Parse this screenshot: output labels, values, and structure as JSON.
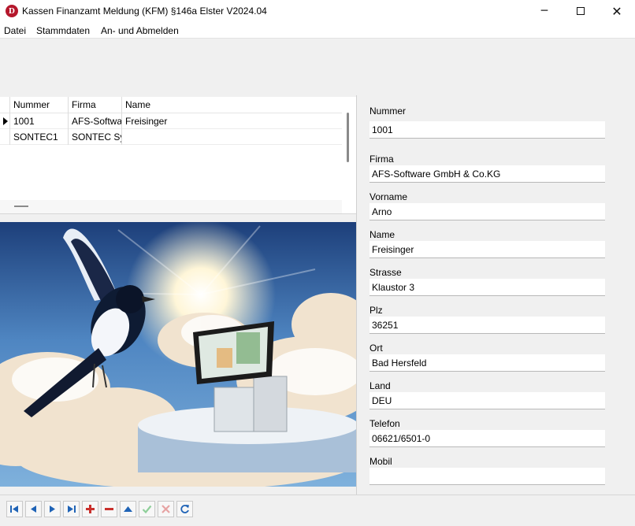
{
  "window": {
    "title": "Kassen Finanzamt Meldung (KFM) §146a Elster V2024.04",
    "app_icon_letter": "D",
    "app_icon_color": "#b5172c",
    "minimize_glyph": "─",
    "close_glyph": "✕"
  },
  "menu": {
    "items": [
      {
        "label": "Datei"
      },
      {
        "label": "Stammdaten"
      },
      {
        "label": "An- und Abmelden"
      }
    ]
  },
  "grid": {
    "columns": [
      "Nummer",
      "Firma",
      "Name"
    ],
    "rows": [
      {
        "nummer": "1001",
        "firma": "AFS-Software GmbH & Co.KG",
        "name": "Freisinger",
        "current": true
      },
      {
        "nummer": "SONTEC1",
        "firma": "SONTEC Systems",
        "name": "",
        "current": false
      }
    ]
  },
  "form": {
    "fields": [
      {
        "label": "Nummer",
        "value": "1001"
      },
      {
        "label": "Firma",
        "value": "AFS-Software GmbH & Co.KG"
      },
      {
        "label": "Vorname",
        "value": "Arno"
      },
      {
        "label": "Name",
        "value": "Freisinger"
      },
      {
        "label": "Strasse",
        "value": "Klaustor 3"
      },
      {
        "label": "Plz",
        "value": "36251"
      },
      {
        "label": "Ort",
        "value": "Bad Hersfeld"
      },
      {
        "label": "Land",
        "value": "DEU"
      },
      {
        "label": "Telefon",
        "value": "06621/6501-0"
      },
      {
        "label": "Mobil",
        "value": ""
      }
    ]
  },
  "navigator": {
    "buttons": [
      {
        "name": "first-record-icon",
        "color": "#1f63b6"
      },
      {
        "name": "prior-record-icon",
        "color": "#1f63b6"
      },
      {
        "name": "next-record-icon",
        "color": "#1f63b6"
      },
      {
        "name": "last-record-icon",
        "color": "#1f63b6"
      },
      {
        "name": "insert-record-icon",
        "color": "#c9302c"
      },
      {
        "name": "delete-record-icon",
        "color": "#c9302c"
      },
      {
        "name": "edit-record-icon",
        "color": "#1f63b6"
      },
      {
        "name": "post-record-icon",
        "color": "#8fcf9a"
      },
      {
        "name": "cancel-edit-icon",
        "color": "#e6a3a3"
      },
      {
        "name": "refresh-icon",
        "color": "#1f63b6"
      }
    ]
  },
  "image": {
    "description_icon": "magpie-over-pos-terminal-picture"
  }
}
